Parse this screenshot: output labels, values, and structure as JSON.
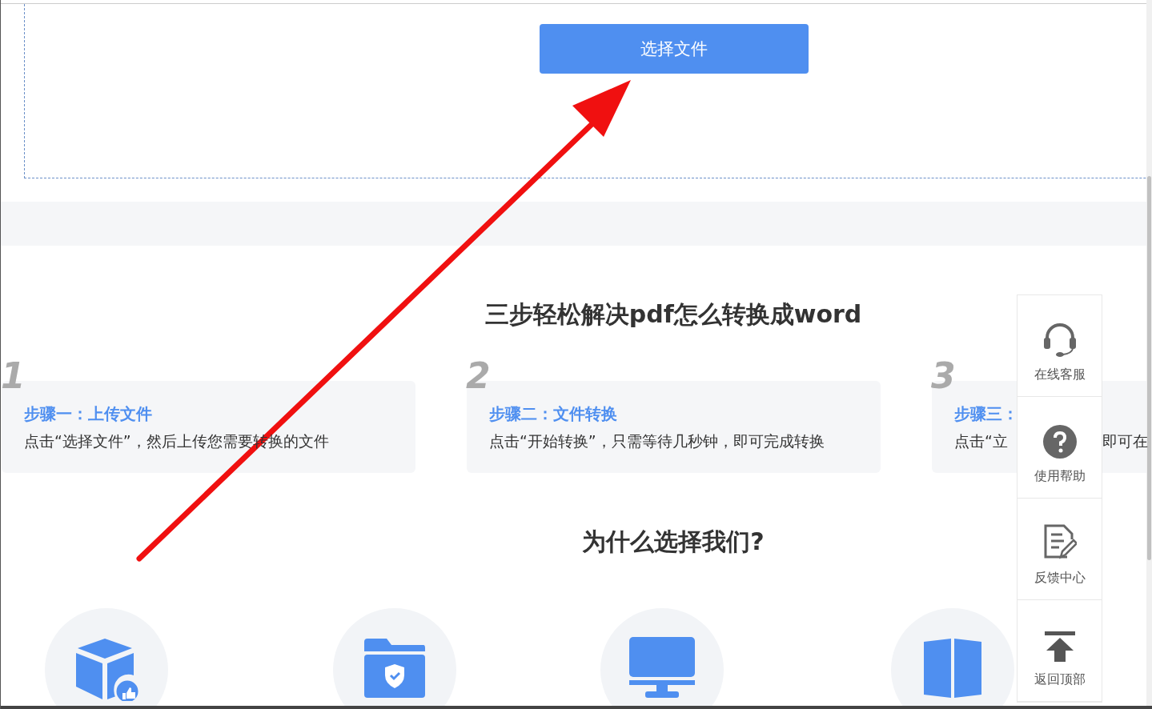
{
  "upload": {
    "button": "选择文件"
  },
  "steps_section": {
    "title": "三步轻松解决pdf怎么转换成word",
    "steps": [
      {
        "number": "1",
        "title": "步骤一：上传文件",
        "description": [
          "点击“选择文件”，然后上传您需要转换的文件"
        ]
      },
      {
        "number": "2",
        "title": "步骤二：文件转换",
        "description": [
          "点击“开始转换”，只需等待几秒钟，即可完成转换"
        ]
      },
      {
        "number": "3",
        "title": "步骤三：",
        "description": [
          "点击“立",
          "即可在"
        ]
      }
    ]
  },
  "why_section": {
    "title": "为什么选择我们?",
    "features": [
      {
        "kind": "cube"
      },
      {
        "kind": "folder"
      },
      {
        "kind": "monitor"
      },
      {
        "kind": "book"
      }
    ]
  },
  "side_panel": [
    {
      "kind": "headset",
      "label": "在线客服"
    },
    {
      "kind": "help",
      "label": "使用帮助"
    },
    {
      "kind": "feedback",
      "label": "反馈中心"
    },
    {
      "kind": "top",
      "label": "返回顶部"
    }
  ]
}
